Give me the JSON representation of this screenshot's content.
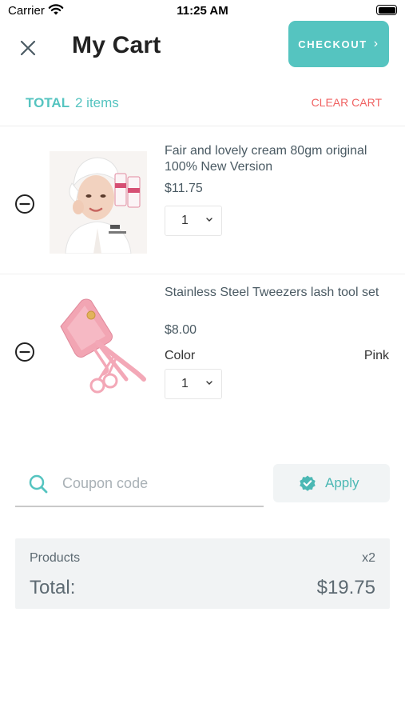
{
  "status_bar": {
    "carrier": "Carrier",
    "time": "11:25 AM"
  },
  "header": {
    "title": "My Cart",
    "checkout_label": "CHECKOUT",
    "checkout_color": "#55c4c0"
  },
  "summary_bar": {
    "total_label": "TOTAL",
    "items_count": "2 items",
    "clear_label": "CLEAR CART"
  },
  "items": [
    {
      "name": "Fair and lovely cream 80gm original 100% New Version",
      "price": "$11.75",
      "quantity": "1",
      "image_icon": "cream-product-photo"
    },
    {
      "name": "Stainless Steel Tweezers lash tool set",
      "price": "$8.00",
      "variant_label": "Color",
      "variant_value": "Pink",
      "quantity": "1",
      "image_icon": "tweezers-set-photo"
    }
  ],
  "coupon": {
    "placeholder": "Coupon code",
    "apply_label": "Apply"
  },
  "totals": {
    "products_label": "Products",
    "products_count": "x2",
    "total_label": "Total:",
    "total_value": "$19.75"
  },
  "colors": {
    "accent": "#55c4c0",
    "danger": "#f06262",
    "panel": "#f1f3f4"
  }
}
